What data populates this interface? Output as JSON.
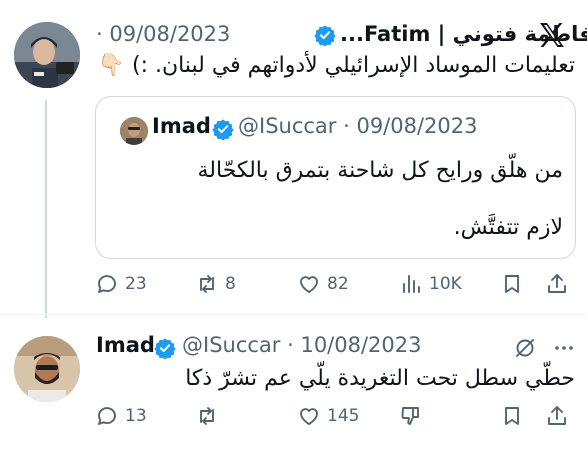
{
  "tweet": {
    "author_name": "فاطمة فتوني | Fatim...",
    "date": "· 09/08/2023",
    "text": "تعليمات الموساد الإسرائيلي لأدواتهم في لبنان. :) 👇🏻",
    "stats": {
      "replies": "23",
      "reposts": "8",
      "likes": "82",
      "views": "10K"
    }
  },
  "quoted": {
    "author_name": "Imad",
    "handle_date": "@ISuccar · 09/08/2023",
    "line1": "من هلّق ورايح كل شاحنة بتمرق بالكحّالة",
    "line2": "لازم تتفتَّش."
  },
  "reply": {
    "author_name": "Imad",
    "handle_date": "@ISuccar · 10/08/2023",
    "text": "حطّي سطل تحت التغريدة يلّي عم تشرّ ذكا",
    "stats": {
      "replies": "13",
      "reposts": "",
      "likes": "145"
    }
  },
  "icons": [
    "x-logo-icon",
    "verified-icon",
    "reply-icon",
    "repost-icon",
    "like-icon",
    "views-icon",
    "bookmark-icon",
    "share-icon",
    "mute-icon",
    "more-icon",
    "dislike-icon"
  ],
  "colors": {
    "verified": "#1d9bf0",
    "text": "#0f1419",
    "muted": "#536471",
    "border": "#cfd9de"
  }
}
